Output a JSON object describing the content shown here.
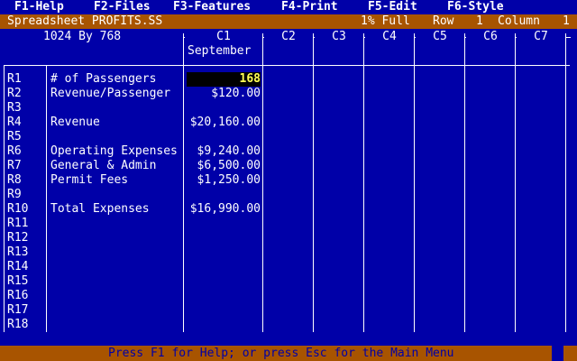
{
  "menu": {
    "items": [
      {
        "key": "F1",
        "label": "F1-Help"
      },
      {
        "key": "F2",
        "label": "F2-Files"
      },
      {
        "key": "F3",
        "label": "F3-Features"
      },
      {
        "key": "F4",
        "label": "F4-Print"
      },
      {
        "key": "F5",
        "label": "F5-Edit"
      },
      {
        "key": "F6",
        "label": "F6-Style"
      }
    ]
  },
  "status": {
    "filename": "Spreadsheet PROFITS.SS",
    "memory": "1% Full",
    "row_label": "Row",
    "row_value": "1",
    "column_label": "Column",
    "column_value": "1"
  },
  "sheet": {
    "resolution": "1024 By 768",
    "columns": [
      {
        "id": "C1",
        "subheader": "September"
      },
      {
        "id": "C2",
        "subheader": ""
      },
      {
        "id": "C3",
        "subheader": ""
      },
      {
        "id": "C4",
        "subheader": ""
      },
      {
        "id": "C5",
        "subheader": ""
      },
      {
        "id": "C6",
        "subheader": ""
      },
      {
        "id": "C7",
        "subheader": ""
      }
    ],
    "rows": [
      {
        "id": "R1",
        "label": "# of Passengers",
        "value": "168",
        "active": true
      },
      {
        "id": "R2",
        "label": "Revenue/Passenger",
        "value": "$120.00"
      },
      {
        "id": "R3",
        "label": "",
        "value": ""
      },
      {
        "id": "R4",
        "label": "Revenue",
        "value": "$20,160.00"
      },
      {
        "id": "R5",
        "label": "",
        "value": ""
      },
      {
        "id": "R6",
        "label": "Operating Expenses",
        "value": "$9,240.00"
      },
      {
        "id": "R7",
        "label": "General & Admin",
        "value": "$6,500.00"
      },
      {
        "id": "R8",
        "label": "Permit Fees",
        "value": "$1,250.00"
      },
      {
        "id": "R9",
        "label": "",
        "value": ""
      },
      {
        "id": "R10",
        "label": "Total Expenses",
        "value": "$16,990.00"
      },
      {
        "id": "R11",
        "label": "",
        "value": ""
      },
      {
        "id": "R12",
        "label": "",
        "value": ""
      },
      {
        "id": "R13",
        "label": "",
        "value": ""
      },
      {
        "id": "R14",
        "label": "",
        "value": ""
      },
      {
        "id": "R15",
        "label": "",
        "value": ""
      },
      {
        "id": "R16",
        "label": "",
        "value": ""
      },
      {
        "id": "R17",
        "label": "",
        "value": ""
      },
      {
        "id": "R18",
        "label": "",
        "value": ""
      }
    ]
  },
  "help_bar": {
    "text": "Press F1 for Help; or press Esc for the Main Menu"
  },
  "colors": {
    "background": "#0000a8",
    "bar": "#a85400",
    "text": "#ffffff",
    "active_cell_bg": "#000000",
    "active_cell_fg": "#ffff55"
  }
}
